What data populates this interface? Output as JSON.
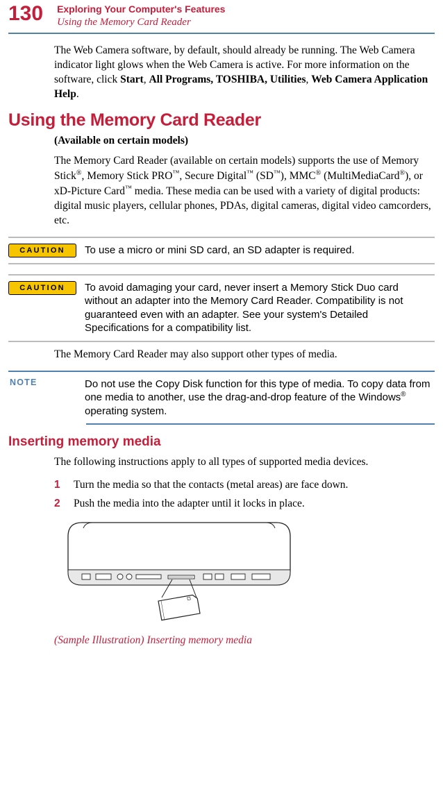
{
  "page_number": "130",
  "chapter_title": "Exploring Your Computer's Features",
  "section_title_header": "Using the Memory Card Reader",
  "intro_para_1a": "The Web Camera software, by default, should already be running. The Web Camera indicator light glows when the Web Camera is active. For more information on the software, click ",
  "intro_start": "Start",
  "intro_sep1": ", ",
  "intro_allprog": "All Programs, TOSHIBA, Utilities",
  "intro_sep2": ", ",
  "intro_help": "Web Camera Application Help",
  "intro_period": ".",
  "h1": "Using the Memory Card Reader",
  "avail": "(Available on certain models)",
  "memory_para": "The Memory Card Reader (available on certain models) supports the use of Memory Stick®, Memory Stick PRO™, Secure Digital™ (SD™), MMC® (MultiMediaCard®), or xD-Picture Card™ media. These media can be used with a variety of digital products: digital music players, cellular phones, PDAs, digital cameras, digital video camcorders, etc.",
  "caution_badge": "CAUTION",
  "caution1": "To use a micro or mini SD card, an SD adapter is required.",
  "caution2": "To avoid damaging your card, never insert a Memory Stick Duo card without an adapter into the Memory Card Reader. Compatibility is not guaranteed even with an adapter. See your system's Detailed Specifications for a compatibility list.",
  "support_line": "The Memory Card Reader may also support other types of media.",
  "note_label": "NOTE",
  "note_text": "Do not use the Copy Disk function for this type of media. To copy data from one media to another, use the drag-and-drop feature of the Windows® operating system.",
  "h2": "Inserting memory media",
  "insert_intro": "The following instructions apply to all types of supported media devices.",
  "step1_num": "1",
  "step1": "Turn the media so that the contacts (metal areas) are face down.",
  "step2_num": "2",
  "step2": "Push the media into the adapter until it locks in place.",
  "caption": "(Sample Illustration) Inserting memory media"
}
